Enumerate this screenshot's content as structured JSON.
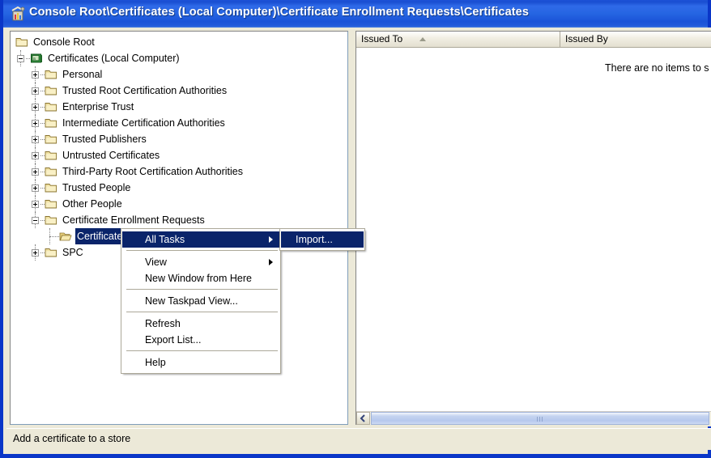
{
  "window": {
    "title": "Console Root\\Certificates (Local Computer)\\Certificate Enrollment Requests\\Certificates",
    "icon": "mmc-console-icon",
    "titlebar_color": "#2565e2",
    "frame_color": "#0a36c8",
    "face_color": "#ece9d8"
  },
  "tree": {
    "items": [
      {
        "label": "Console Root",
        "depth": 0,
        "expander": "none",
        "icon": "folder-icon",
        "selected": false
      },
      {
        "label": "Certificates (Local Computer)",
        "depth": 1,
        "expander": "minus",
        "icon": "certificate-store-icon",
        "selected": false
      },
      {
        "label": "Personal",
        "depth": 2,
        "expander": "plus",
        "icon": "folder-icon",
        "selected": false
      },
      {
        "label": "Trusted Root Certification Authorities",
        "depth": 2,
        "expander": "plus",
        "icon": "folder-icon",
        "selected": false
      },
      {
        "label": "Enterprise Trust",
        "depth": 2,
        "expander": "plus",
        "icon": "folder-icon",
        "selected": false
      },
      {
        "label": "Intermediate Certification Authorities",
        "depth": 2,
        "expander": "plus",
        "icon": "folder-icon",
        "selected": false
      },
      {
        "label": "Trusted Publishers",
        "depth": 2,
        "expander": "plus",
        "icon": "folder-icon",
        "selected": false
      },
      {
        "label": "Untrusted Certificates",
        "depth": 2,
        "expander": "plus",
        "icon": "folder-icon",
        "selected": false
      },
      {
        "label": "Third-Party Root Certification Authorities",
        "depth": 2,
        "expander": "plus",
        "icon": "folder-icon",
        "selected": false
      },
      {
        "label": "Trusted People",
        "depth": 2,
        "expander": "plus",
        "icon": "folder-icon",
        "selected": false
      },
      {
        "label": "Other People",
        "depth": 2,
        "expander": "plus",
        "icon": "folder-icon",
        "selected": false
      },
      {
        "label": "Certificate Enrollment Requests",
        "depth": 2,
        "expander": "minus",
        "icon": "folder-icon",
        "selected": false
      },
      {
        "label": "Certificates",
        "depth": 3,
        "expander": "none",
        "icon": "folder-open-icon",
        "selected": true
      },
      {
        "label": "SPC",
        "depth": 2,
        "expander": "plus",
        "icon": "folder-icon",
        "selected": false
      }
    ],
    "selection_color": "#0a246a"
  },
  "list": {
    "columns": [
      {
        "label": "Issued To",
        "sorted": "asc"
      },
      {
        "label": "Issued By",
        "sorted": "none"
      }
    ],
    "empty_message": "There are no items to s",
    "scrollbar": {
      "left_button_icon": "chevron-left-icon"
    }
  },
  "context_menu": {
    "items": [
      {
        "label": "All Tasks",
        "has_submenu": true,
        "highlighted": true,
        "separator_after": true
      },
      {
        "label": "View",
        "has_submenu": true,
        "highlighted": false,
        "separator_after": false
      },
      {
        "label": "New Window from Here",
        "has_submenu": false,
        "highlighted": false,
        "separator_after": true
      },
      {
        "label": "New Taskpad View...",
        "has_submenu": false,
        "highlighted": false,
        "separator_after": true
      },
      {
        "label": "Refresh",
        "has_submenu": false,
        "highlighted": false,
        "separator_after": false
      },
      {
        "label": "Export List...",
        "has_submenu": false,
        "highlighted": false,
        "separator_after": true
      },
      {
        "label": "Help",
        "has_submenu": false,
        "highlighted": false,
        "separator_after": false
      }
    ],
    "submenu": {
      "items": [
        {
          "label": "Import...",
          "highlighted": true
        }
      ]
    },
    "highlight_color": "#0a246a"
  },
  "status": {
    "text": "Add a certificate to a store"
  }
}
